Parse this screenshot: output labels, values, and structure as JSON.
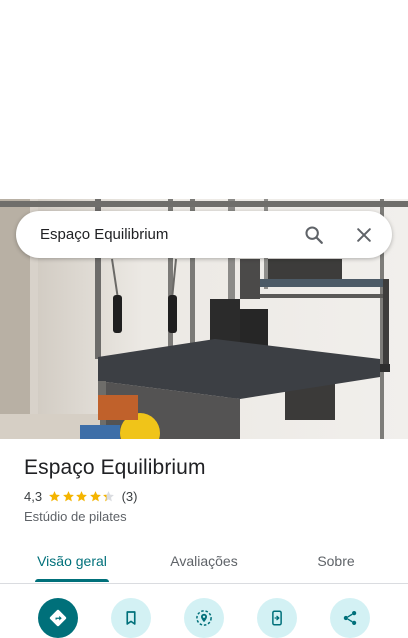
{
  "search": {
    "query": "Espaço Equilibrium",
    "search_icon": "search-icon",
    "close_icon": "close-icon"
  },
  "place": {
    "title": "Espaço Equilibrium",
    "rating": "4,3",
    "rating_stars": 4.3,
    "review_count": "(3)",
    "category": "Estúdio de pilates",
    "photo_subject": "pilates-studio-photo"
  },
  "tabs": {
    "overview": "Visão geral",
    "reviews": "Avaliações",
    "about": "Sobre",
    "active": "overview"
  },
  "actions": [
    {
      "name": "directions-icon"
    },
    {
      "name": "bookmark-icon"
    },
    {
      "name": "nearby-icon"
    },
    {
      "name": "send-to-phone-icon"
    },
    {
      "name": "share-icon"
    }
  ],
  "colors": {
    "accent": "#00707a",
    "action_bg": "#d3f1f4",
    "star": "#f4b400"
  }
}
